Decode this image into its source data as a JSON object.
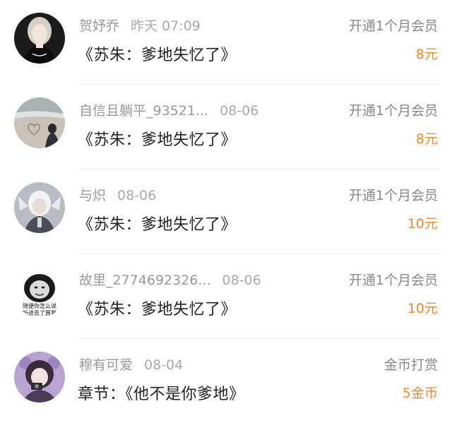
{
  "colors": {
    "amount": "#f08a2c",
    "meta": "#999999",
    "title": "#222222",
    "divider": "#eeeeee"
  },
  "rows": [
    {
      "name": "贺妤乔",
      "time": "昨天 07:09",
      "title": "《苏朱：爹地失忆了》",
      "type": "开通1个月会员",
      "amount": "8元",
      "avatar_icon": "avatar-woman-dark-dress"
    },
    {
      "name": "自信且躺平_93521...",
      "time": "08-06",
      "title": "《苏朱：爹地失忆了》",
      "type": "开通1个月会员",
      "amount": "8元",
      "avatar_icon": "avatar-beach-heart"
    },
    {
      "name": "与炽",
      "time": "08-06",
      "title": "《苏朱：爹地失忆了》",
      "type": "开通1个月会员",
      "amount": "10元",
      "avatar_icon": "avatar-anime-white-hair"
    },
    {
      "name": "故里_2774692326...",
      "time": "08-06",
      "title": "《苏朱：爹地失忆了》",
      "type": "开通1个月会员",
      "amount": "10元",
      "avatar_icon": "avatar-meme-face",
      "avatar_text_1": "随便你怎么说",
      "avatar_text_2": "听进去了算我"
    },
    {
      "name": "穆有可爱",
      "time": "08-04",
      "title": "章节：《他不是你爹地》",
      "type": "金币打赏",
      "amount": "5金币",
      "avatar_icon": "avatar-girl-camera"
    }
  ]
}
